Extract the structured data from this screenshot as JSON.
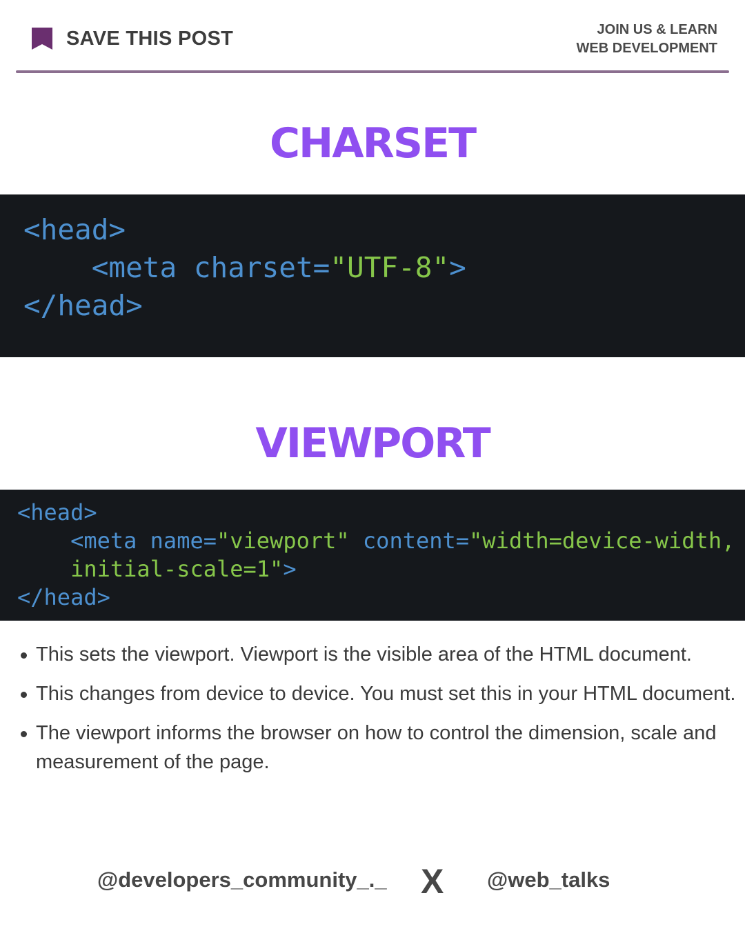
{
  "header": {
    "save_label": "SAVE THIS POST",
    "join_line1": "JOIN US & LEARN",
    "join_line2": "WEB DEVELOPMENT"
  },
  "sections": [
    {
      "title": "CHARSET",
      "code": {
        "line1": "<head>",
        "line2_tag": "<meta",
        "line2_attr": "charset=",
        "line2_value": "\"UTF-8\"",
        "line2_close": ">",
        "line3": "</head>"
      }
    },
    {
      "title": "VIEWPORT",
      "code": {
        "line1": "<head>",
        "line2_tag": "<meta",
        "line2_attr1": "name=",
        "line2_value1": "\"viewport\"",
        "line2_attr2": "content=",
        "line2_value2": "\"width=device-width,",
        "line3_value": "initial-scale=1\"",
        "line3_close": ">",
        "line4": "</head>"
      }
    }
  ],
  "bullets": [
    "This sets the viewport. Viewport is the visible area of the HTML document.",
    "This changes from device to device. You must set this in your HTML document.",
    "The viewport informs the browser on how to control the dimension, scale and measurement of the page."
  ],
  "footer": {
    "handle_left": "@developers_community_._",
    "separator": "X",
    "handle_right": "@web_talks"
  },
  "colors": {
    "accent": "#8f4ff0",
    "divider": "#8b6e8f",
    "code_bg": "#15181c",
    "code_tag": "#4d90cf",
    "code_string": "#86c64a",
    "bookmark": "#6a2f6f"
  },
  "icons": {
    "save": "bookmark-icon"
  }
}
